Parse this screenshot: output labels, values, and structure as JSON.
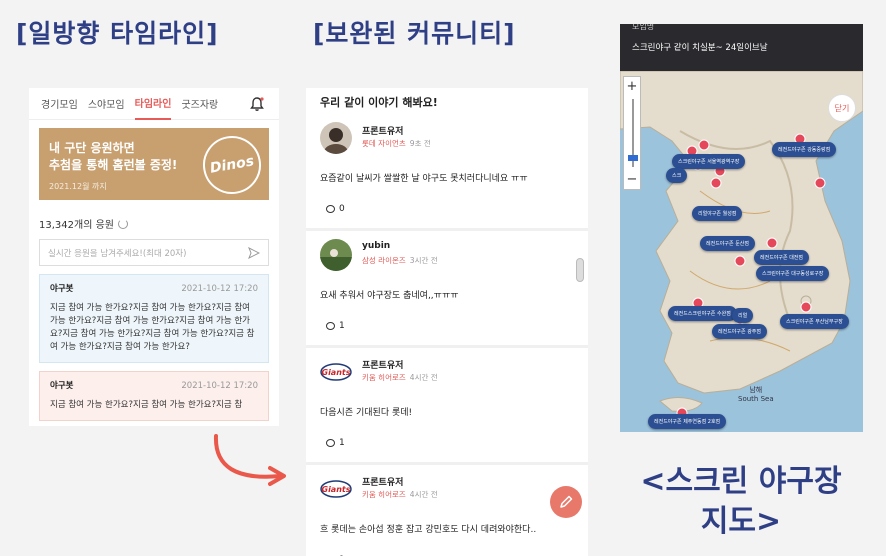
{
  "headlines": {
    "left": "[일방향 타임라인]",
    "middle": "[보완된 커뮤니티]",
    "map_caption_line1": "<스크린 야구장",
    "map_caption_line2": "지도>"
  },
  "timeline": {
    "tabs": [
      {
        "label": "경기모임",
        "active": false
      },
      {
        "label": "스야모임",
        "active": false
      },
      {
        "label": "타임라인",
        "active": true
      },
      {
        "label": "굿즈자랑",
        "active": false
      }
    ],
    "banner": {
      "title": "내 구단 응원하면\n추첨을 통해 홈런볼 증정!",
      "date": "2021.12월 까지",
      "badge": "Dinos"
    },
    "cheer_count": "13,342개의 응원",
    "input_placeholder": "실시간 응원을 남겨주세요!(최대 20자)",
    "messages": [
      {
        "author": "야구봇",
        "time": "2021-10-12 17:20",
        "body": "지금 참여 가능 한가요?지금 참여 가능 한가요?지금 참여 가능 한가요?지금 참여 가능 한가요?지금 참여 가능 한가요?지금 참여 가능 한가요?지금 참여 가능 한가요?지금 참여 가능 한가요?지금 참여 가능 한가요?",
        "tone": "blue"
      },
      {
        "author": "야구봇",
        "time": "2021-10-12 17:20",
        "body": "지금 참여 가능 한가요?지금 참여 가능 한가요?지금 참",
        "tone": "pink"
      }
    ]
  },
  "community": {
    "title": "우리 같이 이야기 해봐요!",
    "posts": [
      {
        "name": "프론트유저",
        "team": "롯데 자이언츠",
        "ago": "9초 전",
        "text": "요즘같이 날씨가 쌀쌀한 날 야구도 못치러다니네요 ㅠㅠ",
        "comments": "0",
        "avatar": "photo"
      },
      {
        "name": "yubin",
        "team": "삼성 라이온즈",
        "ago": "3시간 전",
        "text": "요새 추워서 야구장도 춥네여,,ㅠㅠㅠ",
        "comments": "1",
        "avatar": "field"
      },
      {
        "name": "프론트유저",
        "team": "키움 히어로즈",
        "ago": "4시간 전",
        "text": "다음시즌 기대된다 롯데!",
        "comments": "1",
        "avatar": "giants"
      },
      {
        "name": "프론트유저",
        "team": "키움 히어로즈",
        "ago": "4시간 전",
        "text": "흐 롯데는 손아섭 정훈 잡고 강민호도 다시 데려와야한다..",
        "comments": "1",
        "avatar": "giants"
      }
    ],
    "giants_logo_text": "Giants"
  },
  "map": {
    "header_small": "모임명",
    "header_title": "스크린야구 같이 치실분~ 24일이브날",
    "close_label": "닫기",
    "sea_label_ko": "남해",
    "sea_label_en": "South Sea",
    "pills": [
      "스크린야구존 서울역광역구장",
      "스크",
      "레전드야구존 강동중랑점",
      "리얼야구존 월성점",
      "레전드야구존 둔산점",
      "레전드야구존 대전점",
      "스크린야구존 대구동성로구장",
      "레전드스크린야구존 수완점",
      "레전드야구존 광주점",
      "리얼",
      "스크린야구존 부산남부구장",
      "레전드야구존 제주연동점 2호점"
    ]
  }
}
